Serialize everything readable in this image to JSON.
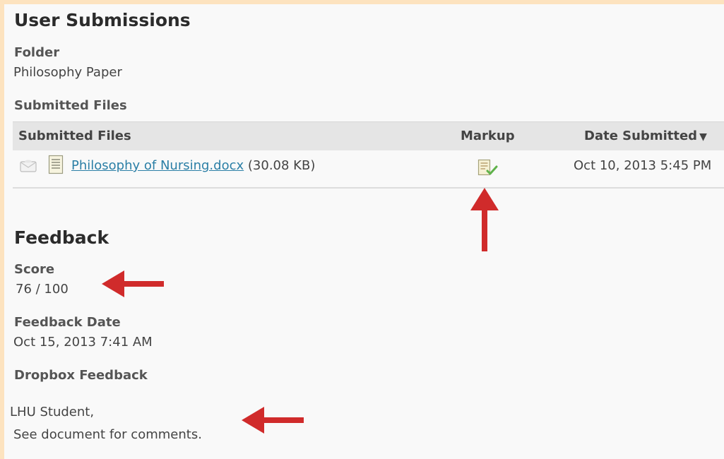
{
  "header": {
    "title": "User Submissions"
  },
  "folder": {
    "label": "Folder",
    "value": "Philosophy Paper"
  },
  "submitted_files_section": {
    "label": "Submitted Files"
  },
  "table": {
    "columns": [
      "Submitted Files",
      "Markup",
      "Date Submitted"
    ],
    "sort_indicator": "▼",
    "rows": [
      {
        "file_name": "Philosophy of Nursing.docx",
        "file_size": "(30.08 KB)",
        "markup_icon": "document-check-icon",
        "date_submitted": "Oct 10, 2013 5:45 PM"
      }
    ]
  },
  "feedback": {
    "title": "Feedback",
    "score_label": "Score",
    "score_value": "76 / 100",
    "date_label": "Feedback Date",
    "date_value": "Oct 15, 2013 7:41 AM",
    "dropbox_label": "Dropbox Feedback",
    "dropbox_line1": "LHU Student,",
    "dropbox_line2": "See document for comments."
  },
  "colors": {
    "frame_border": "#fde3bf",
    "link": "#2b7fa6",
    "annotation_arrow": "#d02b2b",
    "table_header_bg": "#e5e5e5"
  }
}
